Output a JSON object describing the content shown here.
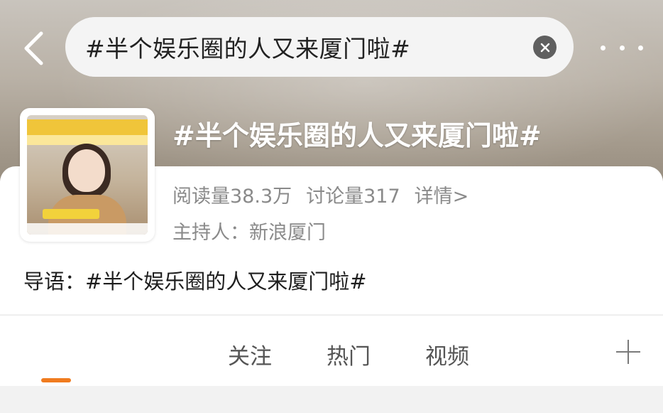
{
  "header": {
    "search_query": "#半个娱乐圈的人又来厦门啦#",
    "back_icon": "chevron-left-icon",
    "clear_icon": "clear-circle-icon",
    "more_icon": "more-dots-icon"
  },
  "topic": {
    "title": "#半个娱乐圈的人又来厦门啦#",
    "reads": "阅读量38.3万",
    "discussions": "讨论量317",
    "details_link": "详情>",
    "host": "主持人：新浪厦门",
    "intro": "导语：#半个娱乐圈的人又来厦门啦#"
  },
  "tabs": [
    {
      "label": "关注"
    },
    {
      "label": "热门"
    },
    {
      "label": "视频"
    }
  ],
  "colors": {
    "accent": "#f07b1f",
    "title_text": "#ffffff",
    "meta_text": "#8a8a8a"
  }
}
